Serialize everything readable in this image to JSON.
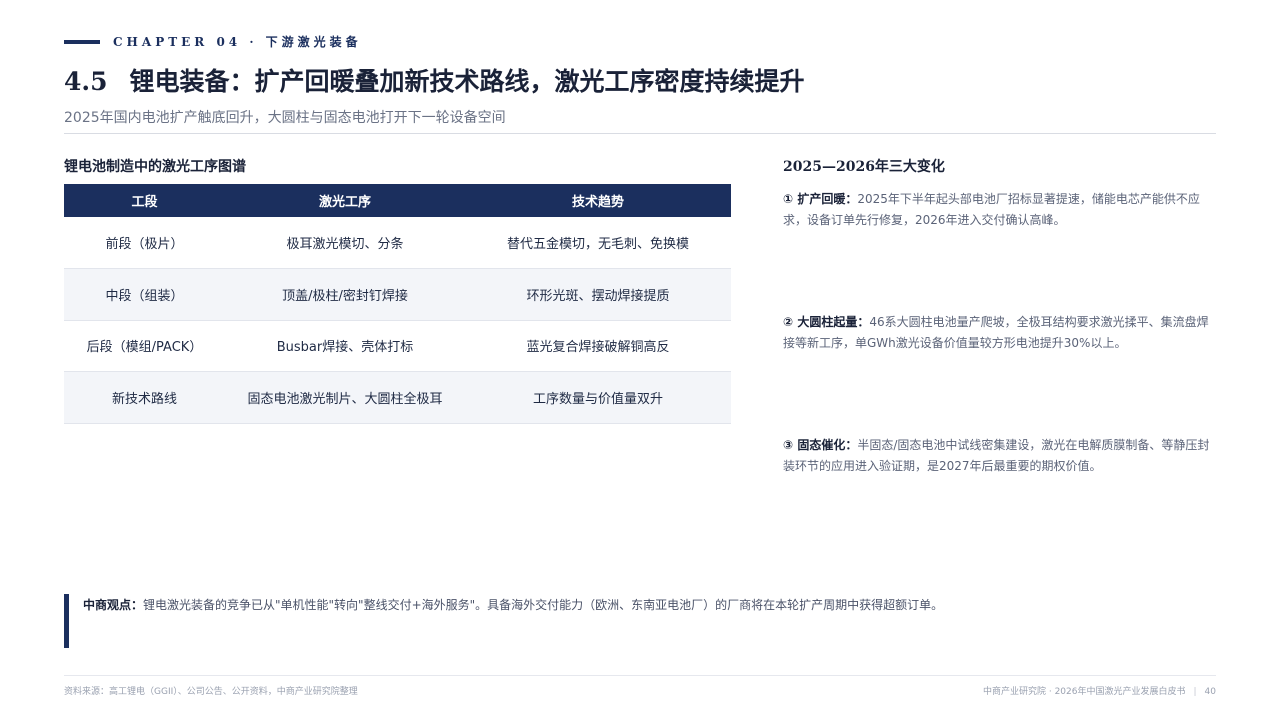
{
  "header": {
    "chapter": "CHAPTER 04 · 下游激光装备",
    "section_number": "4.5",
    "title": "锂电装备：扩产回暖叠加新技术路线，激光工序密度持续提升",
    "subtitle": "2025年国内电池扩产触底回升，大圆柱与固态电池打开下一轮设备空间"
  },
  "table": {
    "title": "锂电池制造中的激光工序图谱",
    "headers": [
      "工段",
      "激光工序",
      "技术趋势"
    ],
    "rows": [
      [
        "前段（极片）",
        "极耳激光模切、分条",
        "替代五金模切，无毛刺、免换模"
      ],
      [
        "中段（组装）",
        "顶盖/极柱/密封钉焊接",
        "环形光斑、摆动焊接提质"
      ],
      [
        "后段（模组/PACK）",
        "Busbar焊接、壳体打标",
        "蓝光复合焊接破解铜高反"
      ],
      [
        "新技术路线",
        "固态电池激光制片、大圆柱全极耳",
        "工序数量与价值量双升"
      ]
    ]
  },
  "changes": {
    "title": "2025—2026年三大变化",
    "items": [
      {
        "lead": "① 扩产回暖：",
        "text": "2025年下半年起头部电池厂招标显著提速，储能电芯产能供不应求，设备订单先行修复，2026年进入交付确认高峰。"
      },
      {
        "lead": "② 大圆柱起量：",
        "text": "46系大圆柱电池量产爬坡，全极耳结构要求激光揉平、集流盘焊接等新工序，单GWh激光设备价值量较方形电池提升30%以上。"
      },
      {
        "lead": "③ 固态催化：",
        "text": "半固态/固态电池中试线密集建设，激光在电解质膜制备、等静压封装环节的应用进入验证期，是2027年后最重要的期权价值。"
      }
    ]
  },
  "viewpoint": {
    "lead": "中商观点：",
    "text": "锂电激光装备的竞争已从\"单机性能\"转向\"整线交付+海外服务\"。具备海外交付能力（欧洲、东南亚电池厂）的厂商将在本轮扩产周期中获得超额订单。"
  },
  "footer": {
    "source": "资料来源：高工锂电（GGII）、公司公告、公开资料，中商产业研究院整理",
    "publisher": "中商产业研究院 · 2026年中国激光产业发展白皮书",
    "page": "40"
  },
  "colors": {
    "accent": "#1b2f5e",
    "row_alt": "#f3f5f9",
    "text_muted": "#6b7386"
  }
}
